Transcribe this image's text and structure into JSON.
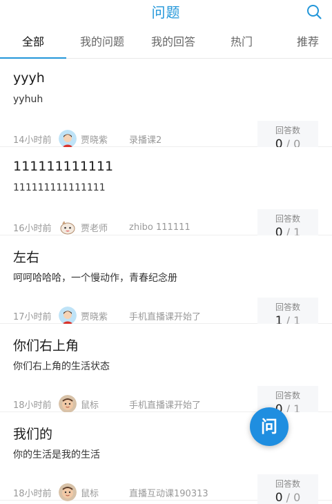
{
  "header": {
    "title": "问题",
    "search_icon": "search-icon"
  },
  "tabs": [
    {
      "label": "全部",
      "active": true
    },
    {
      "label": "我的问题"
    },
    {
      "label": "我的回答"
    },
    {
      "label": "热门"
    },
    {
      "label": "推荐"
    }
  ],
  "questions": [
    {
      "title": "yyyh",
      "body": "yyhuh",
      "time": "14小时前",
      "author": "贾晓紫",
      "avatar": "boy-avatar",
      "course": "录播课2",
      "answers_label": "回答数",
      "answered": "0",
      "total": "/ 0"
    },
    {
      "title": "111111111111",
      "body": "111111111111111",
      "time": "16小时前",
      "author": "贾老师",
      "avatar": "cartoon-avatar",
      "course": "zhibo 111111",
      "answers_label": "回答数",
      "answered": "0",
      "total": "/ 1"
    },
    {
      "title": "左右",
      "body": "呵呵哈哈哈，一个慢动作，青春纪念册",
      "time": "17小时前",
      "author": "贾晓紫",
      "avatar": "boy-avatar",
      "course": "手机直播课开始了",
      "answers_label": "回答数",
      "answered": "1",
      "total": "/ 1"
    },
    {
      "title": "你们右上角",
      "body": "你们右上角的生活状态",
      "time": "18小时前",
      "author": "鼠标",
      "avatar": "baby-avatar",
      "course": "手机直播课开始了",
      "answers_label": "回答数",
      "answered": "0",
      "total": "/ 1"
    },
    {
      "title": "我们的",
      "body": "你的生活是我的生活",
      "time": "18小时前",
      "author": "鼠标",
      "avatar": "baby-avatar",
      "course": "直播互动课190313",
      "answers_label": "回答数",
      "answered": "0",
      "total": "/ 0"
    }
  ],
  "fab": {
    "label": "问"
  },
  "colors": {
    "accent": "#2196d9",
    "fab": "#1f8ee0"
  }
}
